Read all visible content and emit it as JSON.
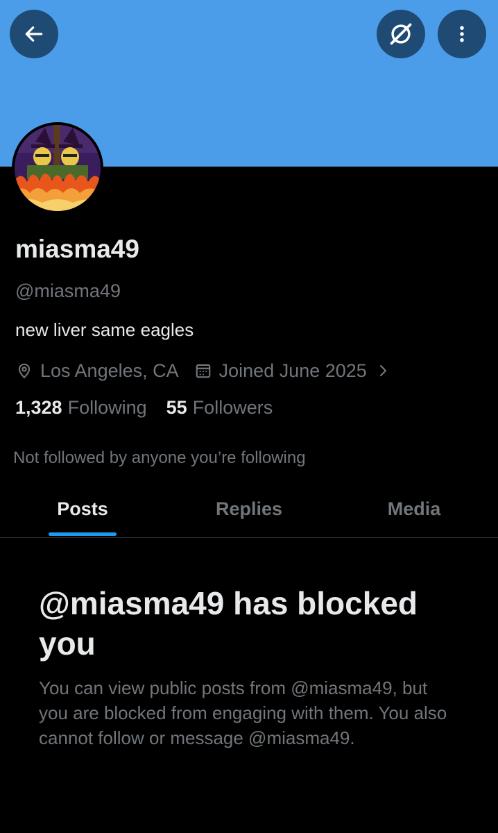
{
  "profile": {
    "display_name": "miasma49",
    "handle": "@miasma49",
    "bio": "new liver same eagles",
    "location": "Los Angeles, CA",
    "joined": "Joined June 2025",
    "following_count": "1,328",
    "following_label": "Following",
    "followers_count": "55",
    "followers_label": "Followers",
    "not_followed_text": "Not followed by anyone you’re following"
  },
  "tabs": [
    {
      "label": "Posts",
      "active": true
    },
    {
      "label": "Replies",
      "active": false
    },
    {
      "label": "Media",
      "active": false
    }
  ],
  "blocked": {
    "title": "@miasma49 has blocked you",
    "description": "You can view public posts from @miasma49, but you are blocked from engaging with them. You also cannot follow or message @miasma49."
  },
  "icons": {
    "back": "arrow-left-icon",
    "grok": "grok-icon",
    "more": "more-vertical-icon",
    "location": "location-pin-icon",
    "calendar": "calendar-icon",
    "chevron": "chevron-right-icon"
  },
  "colors": {
    "banner": "#4c9de9",
    "background": "#000000",
    "accent": "#1d9bf0",
    "muted_text": "#71767b",
    "primary_text": "#e7e9ea"
  }
}
